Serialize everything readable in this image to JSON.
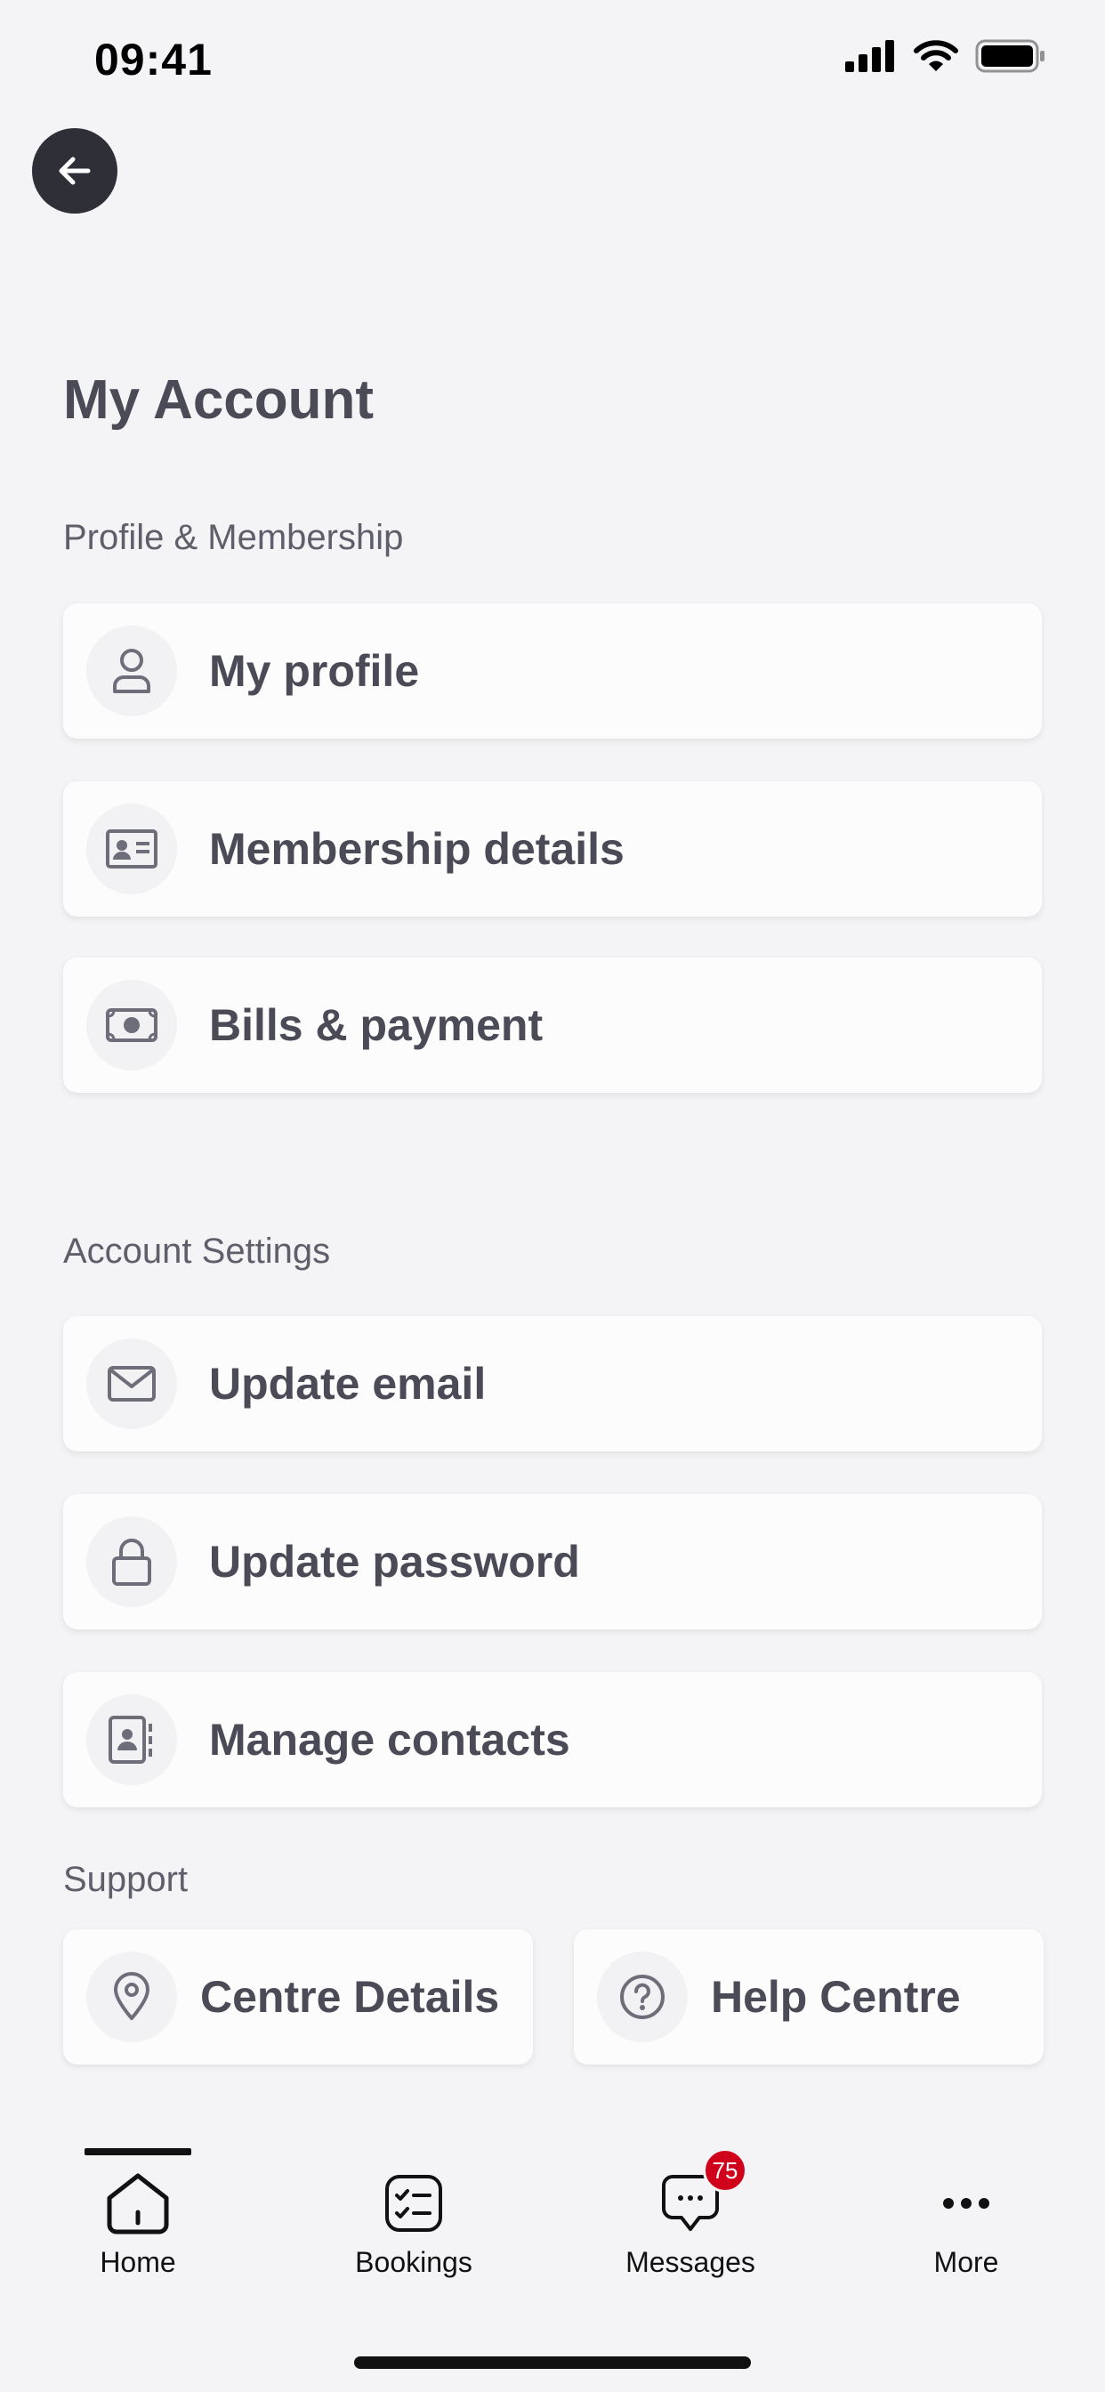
{
  "status_bar": {
    "time": "09:41"
  },
  "header": {
    "title": "My Account"
  },
  "sections": {
    "profile": {
      "label": "Profile & Membership",
      "items": [
        {
          "label": "My profile",
          "icon": "user-icon"
        },
        {
          "label": "Membership details",
          "icon": "id-card-icon"
        },
        {
          "label": "Bills & payment",
          "icon": "banknote-icon"
        }
      ]
    },
    "settings": {
      "label": "Account Settings",
      "items": [
        {
          "label": "Update email",
          "icon": "mail-icon"
        },
        {
          "label": "Update password",
          "icon": "lock-icon"
        },
        {
          "label": "Manage contacts",
          "icon": "contacts-icon"
        }
      ]
    },
    "support": {
      "label": "Support",
      "items": [
        {
          "label": "Centre Details",
          "icon": "map-pin-icon"
        },
        {
          "label": "Help Centre",
          "icon": "help-circle-icon"
        }
      ]
    }
  },
  "tabbar": {
    "tabs": [
      {
        "label": "Home",
        "icon": "home-icon",
        "active": true
      },
      {
        "label": "Bookings",
        "icon": "checklist-icon"
      },
      {
        "label": "Messages",
        "icon": "chat-icon",
        "badge": "75"
      },
      {
        "label": "More",
        "icon": "more-icon"
      }
    ]
  },
  "colors": {
    "badge": "#d0021b",
    "back_button": "#2f2f37",
    "text": "#4b4a57"
  }
}
